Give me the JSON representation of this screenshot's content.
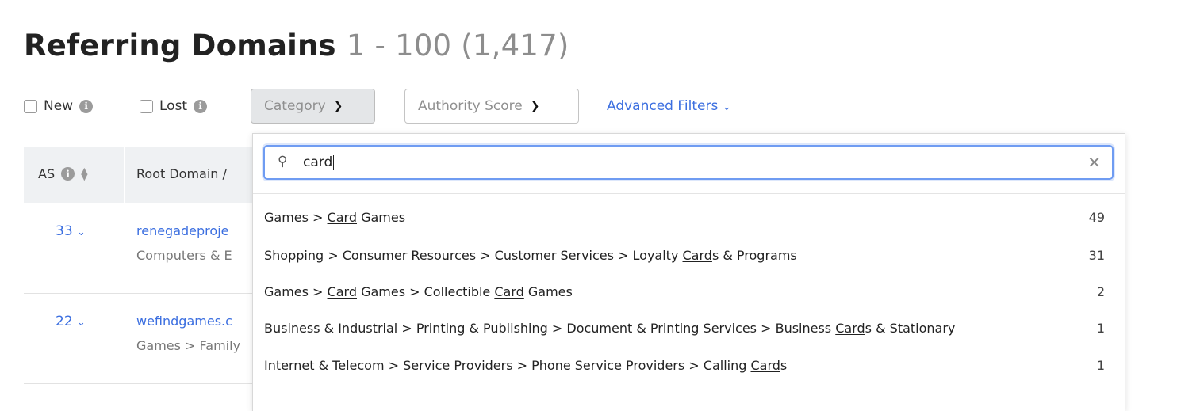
{
  "page": {
    "title": "Referring Domains",
    "range": "1 - 100 (1,417)"
  },
  "filters": {
    "new_label": "New",
    "lost_label": "Lost",
    "category_label": "Category",
    "authority_label": "Authority Score",
    "advanced_label": "Advanced Filters"
  },
  "table": {
    "headers": {
      "as": "AS",
      "root_domain": "Root Domain /"
    },
    "rows": [
      {
        "as": "33",
        "domain": "renegadeproje",
        "category": "Computers & E"
      },
      {
        "as": "22",
        "domain": "wefindgames.c",
        "category": "Games > Family"
      }
    ]
  },
  "category_popup": {
    "search_value": "card",
    "options": [
      {
        "segments": [
          {
            "t": "Games > "
          },
          {
            "t": "Card",
            "u": true
          },
          {
            "t": " Games"
          }
        ],
        "count": "49"
      },
      {
        "segments": [
          {
            "t": "Shopping > Consumer Resources > Customer Services > Loyalty "
          },
          {
            "t": "Card",
            "u": true
          },
          {
            "t": "s & Programs"
          }
        ],
        "count": "31"
      },
      {
        "segments": [
          {
            "t": "Games > "
          },
          {
            "t": "Card",
            "u": true
          },
          {
            "t": " Games > Collectible "
          },
          {
            "t": "Card",
            "u": true
          },
          {
            "t": " Games"
          }
        ],
        "count": "2"
      },
      {
        "segments": [
          {
            "t": "Business & Industrial > Printing & Publishing > Document & Printing Services > Business "
          },
          {
            "t": "Card",
            "u": true
          },
          {
            "t": "s & Stationary"
          }
        ],
        "count": "1"
      },
      {
        "segments": [
          {
            "t": "Internet & Telecom > Service Providers > Phone Service Providers > Calling "
          },
          {
            "t": "Card",
            "u": true
          },
          {
            "t": "s"
          }
        ],
        "count": "1"
      }
    ]
  },
  "colors": {
    "link": "#3c6fe0",
    "focus_border": "#6f9cf2",
    "header_bg": "#eff1f3"
  },
  "icons": [
    "info-icon",
    "sort-icon",
    "chevron-down-icon",
    "search-icon",
    "close-icon",
    "checkbox-icon"
  ]
}
